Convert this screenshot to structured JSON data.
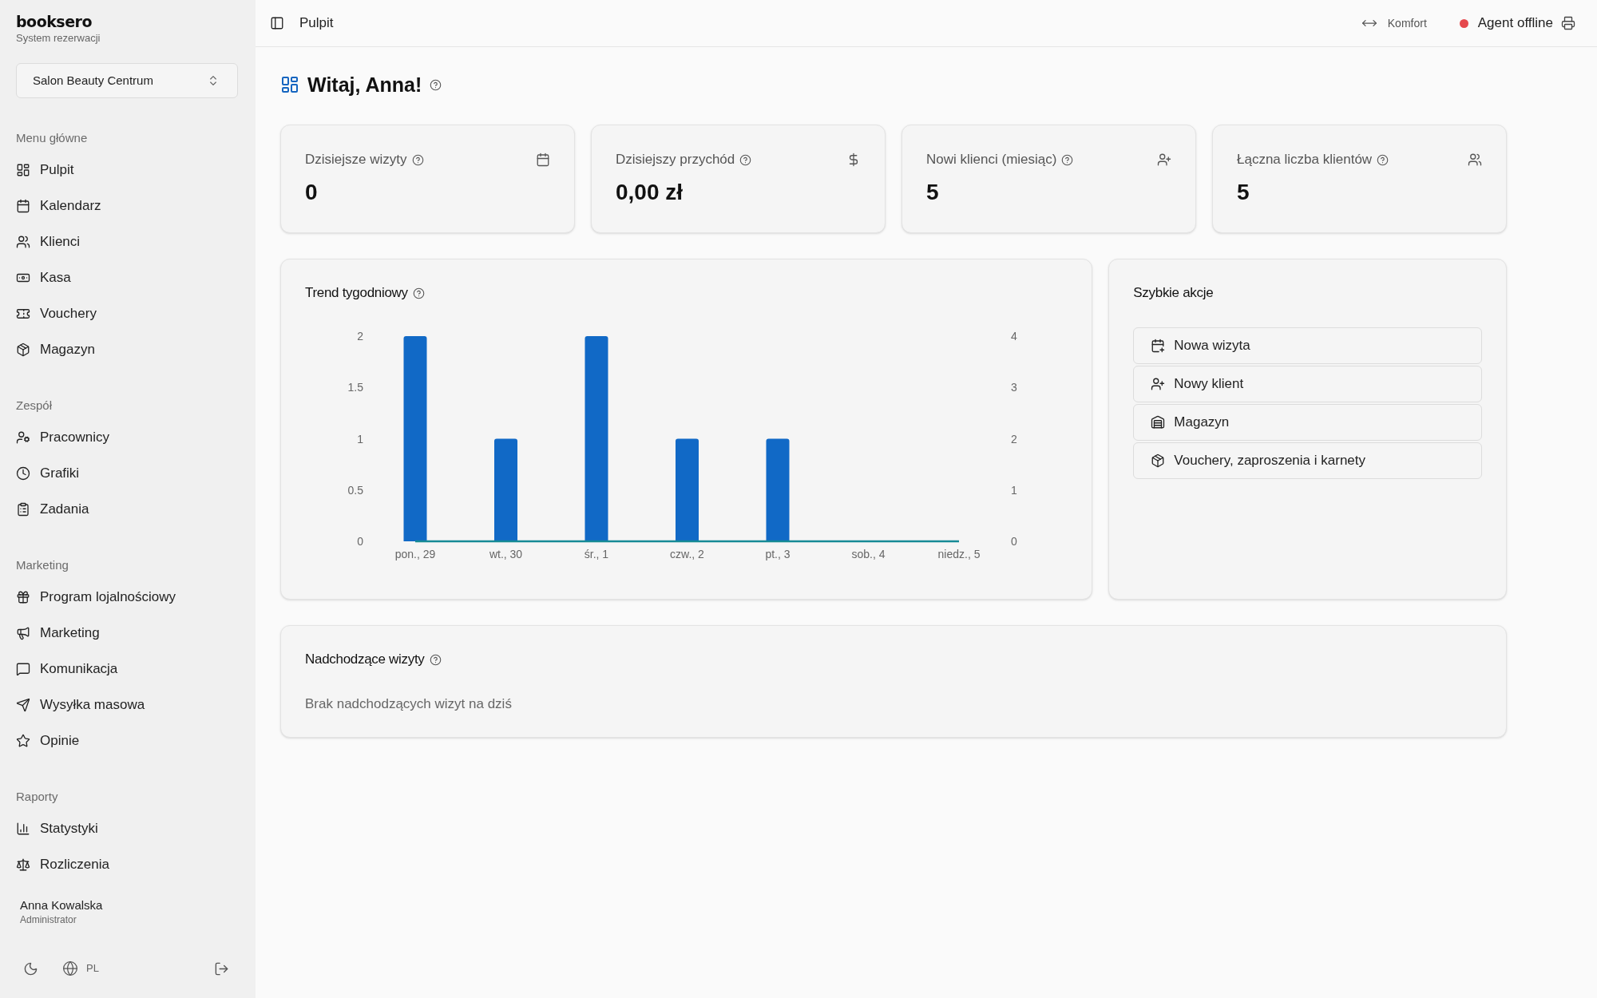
{
  "sidebar": {
    "brand": {
      "name": "booksero",
      "subtitle": "System rezerwacji"
    },
    "location_select": {
      "value": "Salon Beauty Centrum"
    },
    "sections": [
      {
        "title": "Menu główne",
        "items": [
          {
            "label": "Pulpit"
          },
          {
            "label": "Kalendarz"
          },
          {
            "label": "Klienci"
          },
          {
            "label": "Kasa"
          },
          {
            "label": "Vouchery"
          },
          {
            "label": "Magazyn"
          }
        ]
      },
      {
        "title": "Zespół",
        "items": [
          {
            "label": "Pracownicy"
          },
          {
            "label": "Grafiki"
          },
          {
            "label": "Zadania"
          }
        ]
      },
      {
        "title": "Marketing",
        "items": [
          {
            "label": "Program lojalnościowy"
          },
          {
            "label": "Marketing"
          },
          {
            "label": "Komunikacja"
          },
          {
            "label": "Wysyłka masowa"
          },
          {
            "label": "Opinie"
          }
        ]
      },
      {
        "title": "Raporty",
        "items": [
          {
            "label": "Statystyki"
          },
          {
            "label": "Rozliczenia"
          }
        ]
      }
    ],
    "user": {
      "name": "Anna Kowalska",
      "role": "Administrator"
    },
    "footer": {
      "language": "PL"
    }
  },
  "header": {
    "title": "Pulpit",
    "density": "Komfort",
    "agent": {
      "label": "Agent offline",
      "online": false
    }
  },
  "greeting": "Witaj, Anna!",
  "stats": [
    {
      "label": "Dzisiejsze wizyty",
      "value": "0"
    },
    {
      "label": "Dzisiejszy przychód",
      "value": "0,00 zł"
    },
    {
      "label": "Nowi klienci (miesiąc)",
      "value": "5"
    },
    {
      "label": "Łączna liczba klientów",
      "value": "5"
    }
  ],
  "trend": {
    "title": "Trend tygodniowy",
    "chart_data": {
      "type": "bar",
      "categories": [
        "pon., 29",
        "wt., 30",
        "śr., 1",
        "czw., 2",
        "pt., 3",
        "sob., 4",
        "niedz., 5"
      ],
      "series": [
        {
          "color": "#1169c6",
          "values": [
            2,
            1,
            2,
            1,
            1,
            0,
            0
          ]
        },
        {
          "type": "line",
          "axis": "y2",
          "color": "#168a96",
          "values": [
            0,
            0,
            0,
            0,
            0,
            0,
            0
          ]
        }
      ],
      "ylim": [
        0,
        2
      ],
      "yticks": [
        0,
        0.5,
        1,
        1.5,
        2
      ],
      "y2lim": [
        0,
        4
      ],
      "y2ticks": [
        0,
        1,
        2,
        3,
        4
      ]
    }
  },
  "quick_actions": {
    "title": "Szybkie akcje",
    "buttons": [
      {
        "label": "Nowa wizyta"
      },
      {
        "label": "Nowy klient"
      },
      {
        "label": "Magazyn"
      },
      {
        "label": "Vouchery, zaproszenia i karnety"
      }
    ]
  },
  "upcoming": {
    "title": "Nadchodzące wizyty",
    "empty_text": "Brak nadchodzących wizyt na dziś"
  }
}
